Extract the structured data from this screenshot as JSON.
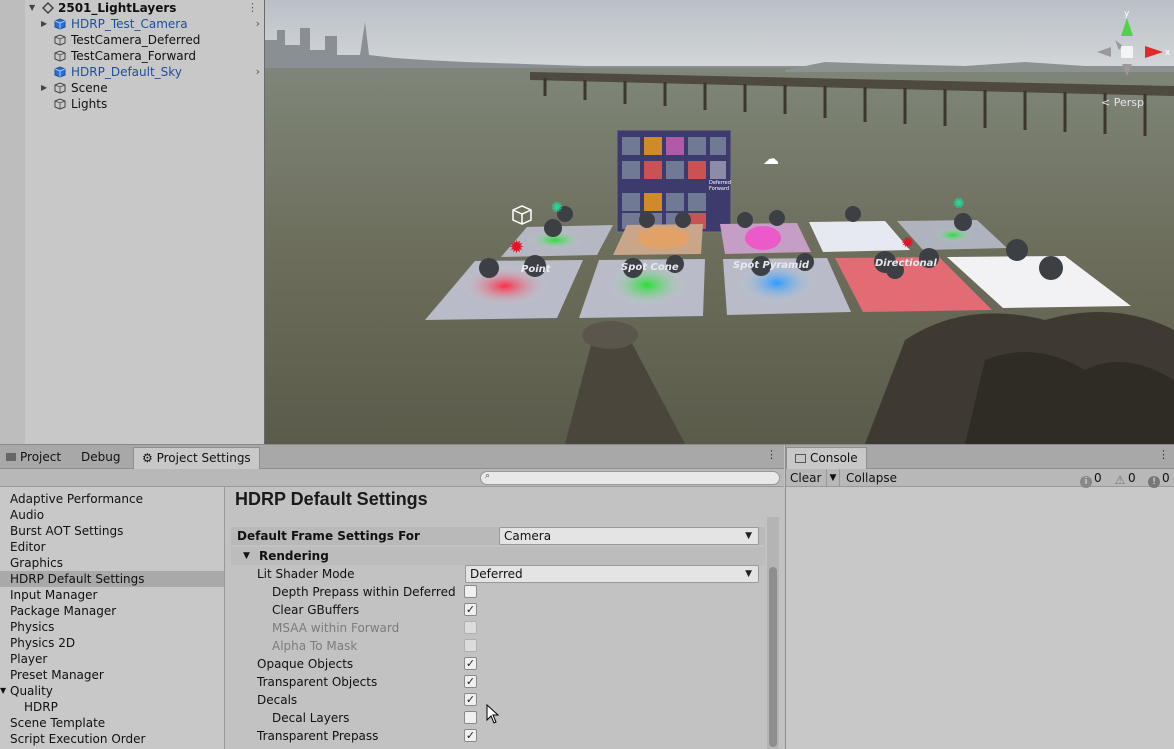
{
  "hierarchy": {
    "scene_name": "2501_LightLayers",
    "items": [
      {
        "label": "HDRP_Test_Camera",
        "prefab": true,
        "expandable": true,
        "has_more": true
      },
      {
        "label": "TestCamera_Deferred",
        "prefab": false,
        "expandable": false
      },
      {
        "label": "TestCamera_Forward",
        "prefab": false,
        "expandable": false
      },
      {
        "label": "HDRP_Default_Sky",
        "prefab": true,
        "expandable": false,
        "has_more": true
      },
      {
        "label": "Scene",
        "prefab": false,
        "expandable": true
      },
      {
        "label": "Lights",
        "prefab": false,
        "expandable": false
      }
    ]
  },
  "viewport": {
    "persp_label": "< Persp",
    "gizmo_axes": {
      "y": "y",
      "x": "x"
    },
    "board_labels": [
      "Point",
      "Spot Cone",
      "Spot Pyramid",
      "Directional"
    ],
    "board_small": [
      "Deferred",
      "Forward"
    ]
  },
  "bottom_tabs": {
    "project": "Project",
    "debug": "Debug",
    "project_settings": "Project Settings",
    "console": "Console"
  },
  "settings_nav": [
    "Adaptive Performance",
    "Audio",
    "Burst AOT Settings",
    "Editor",
    "Graphics",
    "HDRP Default Settings",
    "Input Manager",
    "Package Manager",
    "Physics",
    "Physics 2D",
    "Player",
    "Preset Manager",
    "Quality",
    "HDRP",
    "Scene Template",
    "Script Execution Order"
  ],
  "settings_nav_selected": "HDRP Default Settings",
  "content": {
    "title": "HDRP Default Settings",
    "frame_settings_label": "Default Frame Settings For",
    "frame_settings_value": "Camera",
    "section": "Rendering",
    "lit_shader_mode_label": "Lit Shader Mode",
    "lit_shader_mode_value": "Deferred",
    "options": [
      {
        "label": "Depth Prepass within Deferred",
        "checked": false,
        "enabled": true,
        "indent": 2
      },
      {
        "label": "Clear GBuffers",
        "checked": true,
        "enabled": true,
        "indent": 2
      },
      {
        "label": "MSAA within Forward",
        "checked": false,
        "enabled": false,
        "indent": 2
      },
      {
        "label": "Alpha To Mask",
        "checked": false,
        "enabled": false,
        "indent": 2
      },
      {
        "label": "Opaque Objects",
        "checked": true,
        "enabled": true,
        "indent": 1
      },
      {
        "label": "Transparent Objects",
        "checked": true,
        "enabled": true,
        "indent": 1
      },
      {
        "label": "Decals",
        "checked": true,
        "enabled": true,
        "indent": 1
      },
      {
        "label": "Decal Layers",
        "checked": false,
        "enabled": true,
        "indent": 2
      },
      {
        "label": "Transparent Prepass",
        "checked": true,
        "enabled": true,
        "indent": 1
      }
    ]
  },
  "console": {
    "clear": "Clear",
    "collapse": "Collapse",
    "log_count": "0",
    "warning_count": "0",
    "error_count": "0"
  },
  "colors": {
    "panel": "#c2c2c2",
    "selected": "#a9a9a9",
    "prefab_text": "#1b4f9c",
    "water": "#6e6f5c",
    "sky": "#cfd3d6"
  }
}
